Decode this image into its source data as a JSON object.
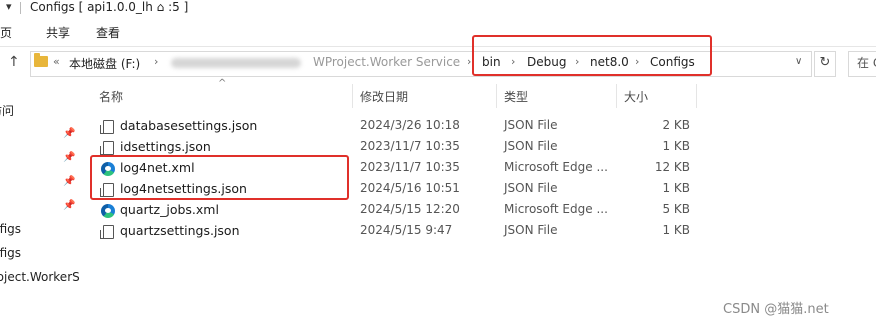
{
  "window": {
    "title": "Configs [ api1.0.0_lh ⌂ :5 ]"
  },
  "ribbon": {
    "tabs": [
      "主页",
      "共享",
      "查看"
    ]
  },
  "address": {
    "more": "«",
    "drive": "本地磁盘 (F:)",
    "partial_path": "WProject.Worker Service",
    "highlighted_crumbs": [
      "bin",
      "Debug",
      "net8.0",
      "Configs"
    ],
    "search_placeholder": "在 C"
  },
  "nav": {
    "items": [
      "访问",
      "nfigs",
      "nfigs",
      "roject.WorkerS"
    ]
  },
  "columns": {
    "name": "名称",
    "date": "修改日期",
    "type": "类型",
    "size": "大小"
  },
  "files": [
    {
      "name": "databasesettings.json",
      "date": "2024/3/26 10:18",
      "type": "JSON File",
      "size": "2 KB",
      "icon": "json-file-icon"
    },
    {
      "name": "idsettings.json",
      "date": "2023/11/7 10:35",
      "type": "JSON File",
      "size": "1 KB",
      "icon": "json-file-icon"
    },
    {
      "name": "log4net.xml",
      "date": "2023/11/7 10:35",
      "type": "Microsoft Edge ...",
      "size": "12 KB",
      "icon": "edge-icon"
    },
    {
      "name": "log4netsettings.json",
      "date": "2024/5/16 10:51",
      "type": "JSON File",
      "size": "1 KB",
      "icon": "json-file-icon"
    },
    {
      "name": "quartz_jobs.xml",
      "date": "2024/5/15 12:20",
      "type": "Microsoft Edge ...",
      "size": "5 KB",
      "icon": "edge-icon"
    },
    {
      "name": "quartzsettings.json",
      "date": "2024/5/15 9:47",
      "type": "JSON File",
      "size": "1 KB",
      "icon": "json-file-icon"
    }
  ],
  "watermark": "CSDN @猫猫.net",
  "colors": {
    "highlight_box": "#e0302a",
    "folder": "#e8b63b"
  }
}
